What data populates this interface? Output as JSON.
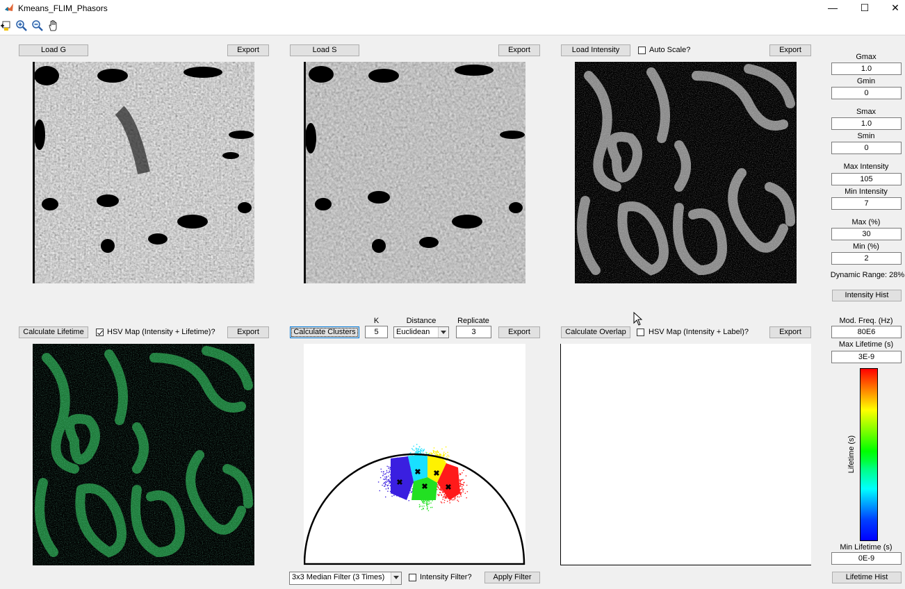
{
  "window": {
    "title": "Kmeans_FLIM_Phasors",
    "min": "—",
    "max": "☐",
    "close": "✕"
  },
  "toolbar": {
    "icons": [
      "data-cursor-icon",
      "zoom-in-icon",
      "zoom-out-icon",
      "pan-hand-icon"
    ]
  },
  "panels": {
    "g": {
      "load_label": "Load G",
      "export_label": "Export"
    },
    "s": {
      "load_label": "Load S",
      "export_label": "Export"
    },
    "intensity": {
      "load_label": "Load Intensity",
      "autoscale_label": "Auto Scale?",
      "autoscale_checked": false,
      "export_label": "Export"
    },
    "lifetime": {
      "calc_label": "Calculate Lifetime",
      "hsv_label": "HSV Map (Intensity + Lifetime)?",
      "hsv_checked": true,
      "export_label": "Export"
    },
    "clusters": {
      "calc_label": "Calculate Clusters",
      "k_label": "K",
      "k_value": "5",
      "distance_label": "Distance",
      "distance_value": "Euclidean",
      "replicate_label": "Replicate",
      "replicate_value": "3",
      "export_label": "Export"
    },
    "overlap": {
      "calc_label": "Calculate Overlap",
      "hsv_label": "HSV Map (Intensity + Label)?",
      "hsv_checked": false,
      "export_label": "Export"
    },
    "filter": {
      "select_value": "3x3 Median Filter (3 Times)",
      "intensity_filter_label": "Intensity Filter?",
      "intensity_filter_checked": false,
      "apply_label": "Apply Filter"
    }
  },
  "side": {
    "gmax_label": "Gmax",
    "gmax_value": "1.0",
    "gmin_label": "Gmin",
    "gmin_value": "0",
    "smax_label": "Smax",
    "smax_value": "1.0",
    "smin_label": "Smin",
    "smin_value": "0",
    "maxint_label": "Max Intensity",
    "maxint_value": "105",
    "minint_label": "Min Intensity",
    "minint_value": "7",
    "maxpct_label": "Max (%)",
    "maxpct_value": "30",
    "minpct_label": "Min (%)",
    "minpct_value": "2",
    "dynamic_range": "Dynamic Range: 28%",
    "intensity_hist_label": "Intensity Hist",
    "modfreq_label": "Mod. Freq. (Hz)",
    "modfreq_value": "80E6",
    "maxlife_label": "Max Lifetime (s)",
    "maxlife_value": "3E-9",
    "colorbar_label": "Lifetime (s)",
    "minlife_label": "Min Lifetime (s)",
    "minlife_value": "0E-9",
    "lifetime_hist_label": "Lifetime Hist"
  },
  "colors": {
    "cluster1": "#3a1fe0",
    "cluster2": "#19e0ff",
    "cluster3": "#fff200",
    "cluster4": "#ff1a1a",
    "cluster5": "#22e022"
  }
}
